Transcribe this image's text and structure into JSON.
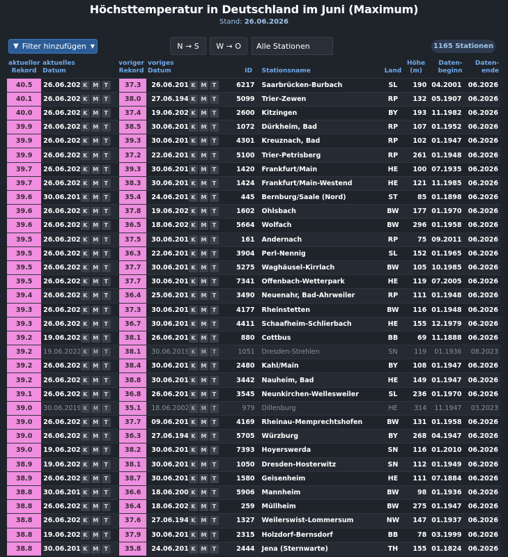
{
  "header": {
    "title": "Höchsttemperatur in Deutschland im Juni (Maximum)",
    "stand_label": "Stand:",
    "stand_date": "26.06.2026"
  },
  "toolbar": {
    "filter_label": "Filter hinzufügen",
    "ns_label": "N → S",
    "wo_label": "W → O",
    "stations_select": "Alle Stationen",
    "station_count": "1165 Stationen"
  },
  "columns": {
    "cur_rec": [
      "aktueller",
      "Rekord"
    ],
    "cur_date": [
      "aktuelles",
      "Datum"
    ],
    "prev_rec": [
      "voriger",
      "Rekord"
    ],
    "prev_date": [
      "voriges",
      "Datum"
    ],
    "id": "ID",
    "name": "Stationsname",
    "land": "Land",
    "height": [
      "Höhe",
      "(m)"
    ],
    "begin": [
      "Daten-",
      "beginn"
    ],
    "end": [
      "Daten-",
      "ende"
    ]
  },
  "kmt": [
    "K",
    "M",
    "T"
  ],
  "rows": [
    [
      "40.5",
      "26.06.2026",
      "37.3",
      "26.06.2019",
      "6217",
      "Saarbrücken-Burbach",
      "SL",
      "190",
      "04.2001",
      "06.2026",
      1
    ],
    [
      "40.1",
      "26.06.2026",
      "38.0",
      "27.06.1947",
      "5099",
      "Trier-Zewen",
      "RP",
      "132",
      "05.1907",
      "06.2026",
      1
    ],
    [
      "40.0",
      "26.06.2026",
      "37.4",
      "19.06.2022",
      "2600",
      "Kitzingen",
      "BY",
      "193",
      "11.1982",
      "06.2026",
      1
    ],
    [
      "39.9",
      "26.06.2026",
      "38.5",
      "30.06.2019",
      "1072",
      "Dürkheim, Bad",
      "RP",
      "107",
      "01.1952",
      "06.2026",
      1
    ],
    [
      "39.9",
      "26.06.2026",
      "39.3",
      "30.06.2019",
      "4301",
      "Kreuznach, Bad",
      "RP",
      "102",
      "01.1947",
      "06.2026",
      1
    ],
    [
      "39.9",
      "26.06.2026",
      "37.2",
      "22.06.2017",
      "5100",
      "Trier-Petrisberg",
      "RP",
      "261",
      "01.1948",
      "06.2026",
      1
    ],
    [
      "39.7",
      "26.06.2026",
      "39.3",
      "30.06.2019",
      "1420",
      "Frankfurt/Main",
      "HE",
      "100",
      "07.1935",
      "06.2026",
      1
    ],
    [
      "39.7",
      "26.06.2026",
      "38.3",
      "30.06.2019",
      "1424",
      "Frankfurt/Main-Westend",
      "HE",
      "121",
      "11.1985",
      "06.2026",
      1
    ],
    [
      "39.6",
      "30.06.2019",
      "35.4",
      "24.06.2016",
      "445",
      "Bernburg/Saale (Nord)",
      "ST",
      "85",
      "01.1898",
      "06.2026",
      1
    ],
    [
      "39.6",
      "26.06.2026",
      "37.8",
      "19.06.2022",
      "1602",
      "Ohlsbach",
      "BW",
      "177",
      "01.1970",
      "06.2026",
      1
    ],
    [
      "39.6",
      "26.06.2026",
      "36.5",
      "18.06.2022",
      "5664",
      "Wolfach",
      "BW",
      "296",
      "01.1958",
      "06.2026",
      1
    ],
    [
      "39.5",
      "26.06.2026",
      "37.5",
      "30.06.2019",
      "161",
      "Andernach",
      "RP",
      "75",
      "09.2011",
      "06.2026",
      1
    ],
    [
      "39.5",
      "26.06.2026",
      "36.3",
      "22.06.2017",
      "3904",
      "Perl-Nennig",
      "SL",
      "152",
      "01.1965",
      "06.2026",
      1
    ],
    [
      "39.5",
      "26.06.2026",
      "37.7",
      "30.06.2019",
      "5275",
      "Waghäusel-Kirrlach",
      "BW",
      "105",
      "10.1985",
      "06.2026",
      1
    ],
    [
      "39.5",
      "26.06.2026",
      "37.7",
      "30.06.2019",
      "7341",
      "Offenbach-Wetterpark",
      "HE",
      "119",
      "07.2005",
      "06.2026",
      1
    ],
    [
      "39.4",
      "26.06.2026",
      "36.4",
      "25.06.2019",
      "3490",
      "Neuenahr, Bad-Ahrweiler",
      "RP",
      "111",
      "01.1948",
      "06.2026",
      1
    ],
    [
      "39.3",
      "26.06.2026",
      "37.3",
      "30.06.2019",
      "4177",
      "Rheinstetten",
      "BW",
      "116",
      "01.1948",
      "06.2026",
      1
    ],
    [
      "39.3",
      "26.06.2026",
      "36.7",
      "30.06.2019",
      "4411",
      "Schaafheim-Schlierbach",
      "HE",
      "155",
      "12.1979",
      "06.2026",
      1
    ],
    [
      "39.2",
      "19.06.2022",
      "38.1",
      "26.06.2019",
      "880",
      "Cottbus",
      "BB",
      "69",
      "11.1888",
      "06.2026",
      1
    ],
    [
      "39.2",
      "19.06.2022",
      "38.1",
      "30.06.2019",
      "1051",
      "Dresden-Strehlen",
      "SN",
      "119",
      "01.1936",
      "08.2023",
      0
    ],
    [
      "39.2",
      "26.06.2026",
      "38.4",
      "30.06.2019",
      "2480",
      "Kahl/Main",
      "BY",
      "108",
      "01.1947",
      "06.2026",
      1
    ],
    [
      "39.2",
      "26.06.2026",
      "38.8",
      "30.06.2019",
      "3442",
      "Nauheim, Bad",
      "HE",
      "149",
      "01.1947",
      "06.2026",
      1
    ],
    [
      "39.1",
      "26.06.2026",
      "36.8",
      "26.06.2019",
      "3545",
      "Neunkirchen-Wellesweiler",
      "SL",
      "236",
      "01.1970",
      "06.2026",
      1
    ],
    [
      "39.0",
      "30.06.2019",
      "35.1",
      "18.06.2002",
      "979",
      "Dillenburg",
      "HE",
      "314",
      "11.1947",
      "03.2023",
      0
    ],
    [
      "39.0",
      "26.06.2026",
      "37.7",
      "09.06.2014",
      "4169",
      "Rheinau-Memprechtshofen",
      "BW",
      "131",
      "01.1958",
      "06.2026",
      1
    ],
    [
      "39.0",
      "26.06.2026",
      "36.3",
      "27.06.1947",
      "5705",
      "Würzburg",
      "BY",
      "268",
      "04.1947",
      "06.2026",
      1
    ],
    [
      "39.0",
      "19.06.2022",
      "38.2",
      "30.06.2019",
      "7393",
      "Hoyerswerda",
      "SN",
      "116",
      "01.2010",
      "06.2026",
      1
    ],
    [
      "38.9",
      "19.06.2022",
      "38.1",
      "30.06.2019",
      "1050",
      "Dresden-Hosterwitz",
      "SN",
      "112",
      "01.1949",
      "06.2026",
      1
    ],
    [
      "38.9",
      "26.06.2026",
      "38.7",
      "30.06.2019",
      "1580",
      "Geisenheim",
      "HE",
      "111",
      "07.1884",
      "06.2026",
      1
    ],
    [
      "38.8",
      "30.06.2019",
      "36.6",
      "18.06.2002",
      "5906",
      "Mannheim",
      "BW",
      "98",
      "01.1936",
      "06.2026",
      1
    ],
    [
      "38.8",
      "26.06.2026",
      "36.4",
      "18.06.2022",
      "259",
      "Müllheim",
      "BW",
      "275",
      "01.1947",
      "06.2026",
      1
    ],
    [
      "38.8",
      "26.06.2026",
      "37.6",
      "27.06.1947",
      "1327",
      "Weilerswist-Lommersum",
      "NW",
      "147",
      "01.1937",
      "06.2026",
      1
    ],
    [
      "38.8",
      "19.06.2022",
      "37.9",
      "30.06.2019",
      "2315",
      "Holzdorf-Bernsdorf",
      "BB",
      "78",
      "03.1999",
      "06.2026",
      1
    ],
    [
      "38.8",
      "30.06.2019",
      "35.8",
      "24.06.2016",
      "2444",
      "Jena (Sternwarte)",
      "TH",
      "155",
      "01.1824",
      "06.2026",
      1
    ]
  ]
}
